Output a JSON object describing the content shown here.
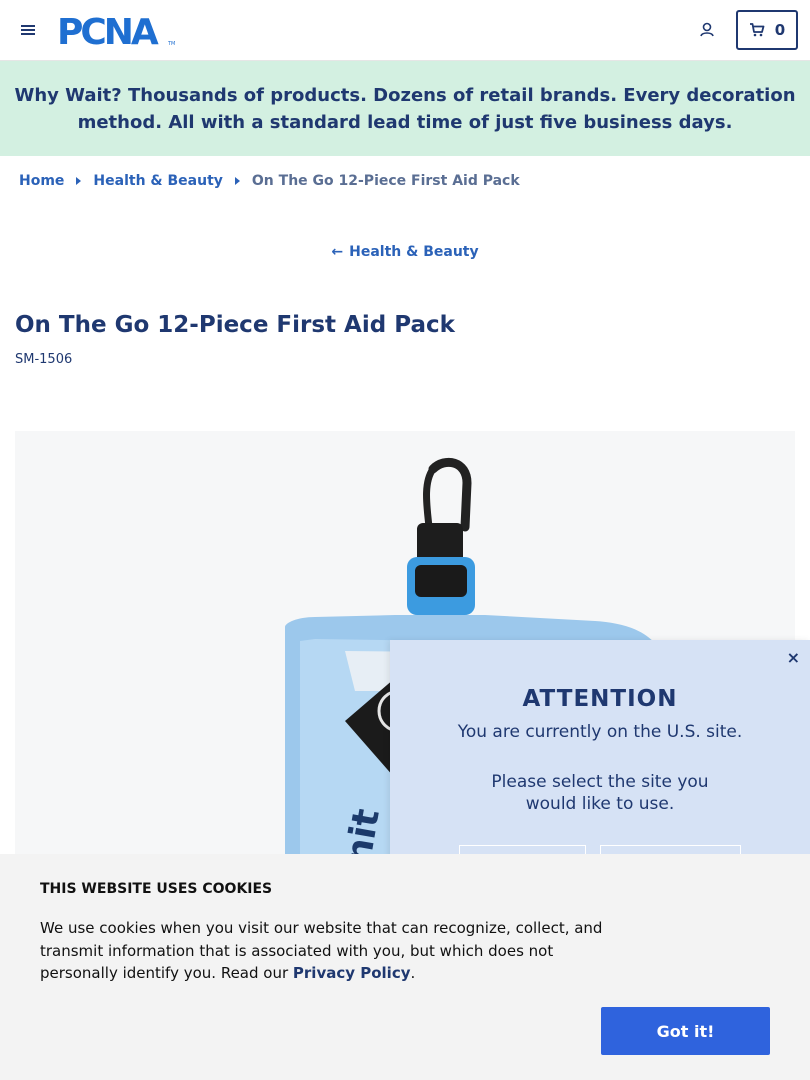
{
  "header": {
    "logo_text": "PCNA",
    "cart_count": "0"
  },
  "promo": {
    "lead": "Why Wait?",
    "text": " Thousands of products. Dozens of retail brands. Every decoration method. All with a standard lead time of just five business days."
  },
  "breadcrumb": {
    "items": [
      "Home",
      "Health & Beauty"
    ],
    "current": "On The Go 12-Piece First Aid Pack"
  },
  "back_link": "Health & Beauty",
  "product": {
    "title": "On The Go 12-Piece First Aid Pack",
    "sku": "SM-1506"
  },
  "site_modal": {
    "heading": "ATTENTION",
    "line1": "You are currently on the U.S. site.",
    "line2": "Please select the site you would like to use.",
    "close": "×"
  },
  "cookie_banner": {
    "heading": "THIS WEBSITE USES COOKIES",
    "body": "We use cookies when you visit our website that can recognize, collect, and transmit information that is associated with you, but which does not personally identify you. Read our ",
    "link": "Privacy Policy",
    "end": ".",
    "button": "Got it!"
  },
  "colors": {
    "brand_navy": "#1f3870",
    "link_blue": "#2b62b8",
    "promo_bg": "#d3f0e1",
    "modal_bg": "#d6e2f5",
    "cta_blue": "#2f63dd"
  }
}
